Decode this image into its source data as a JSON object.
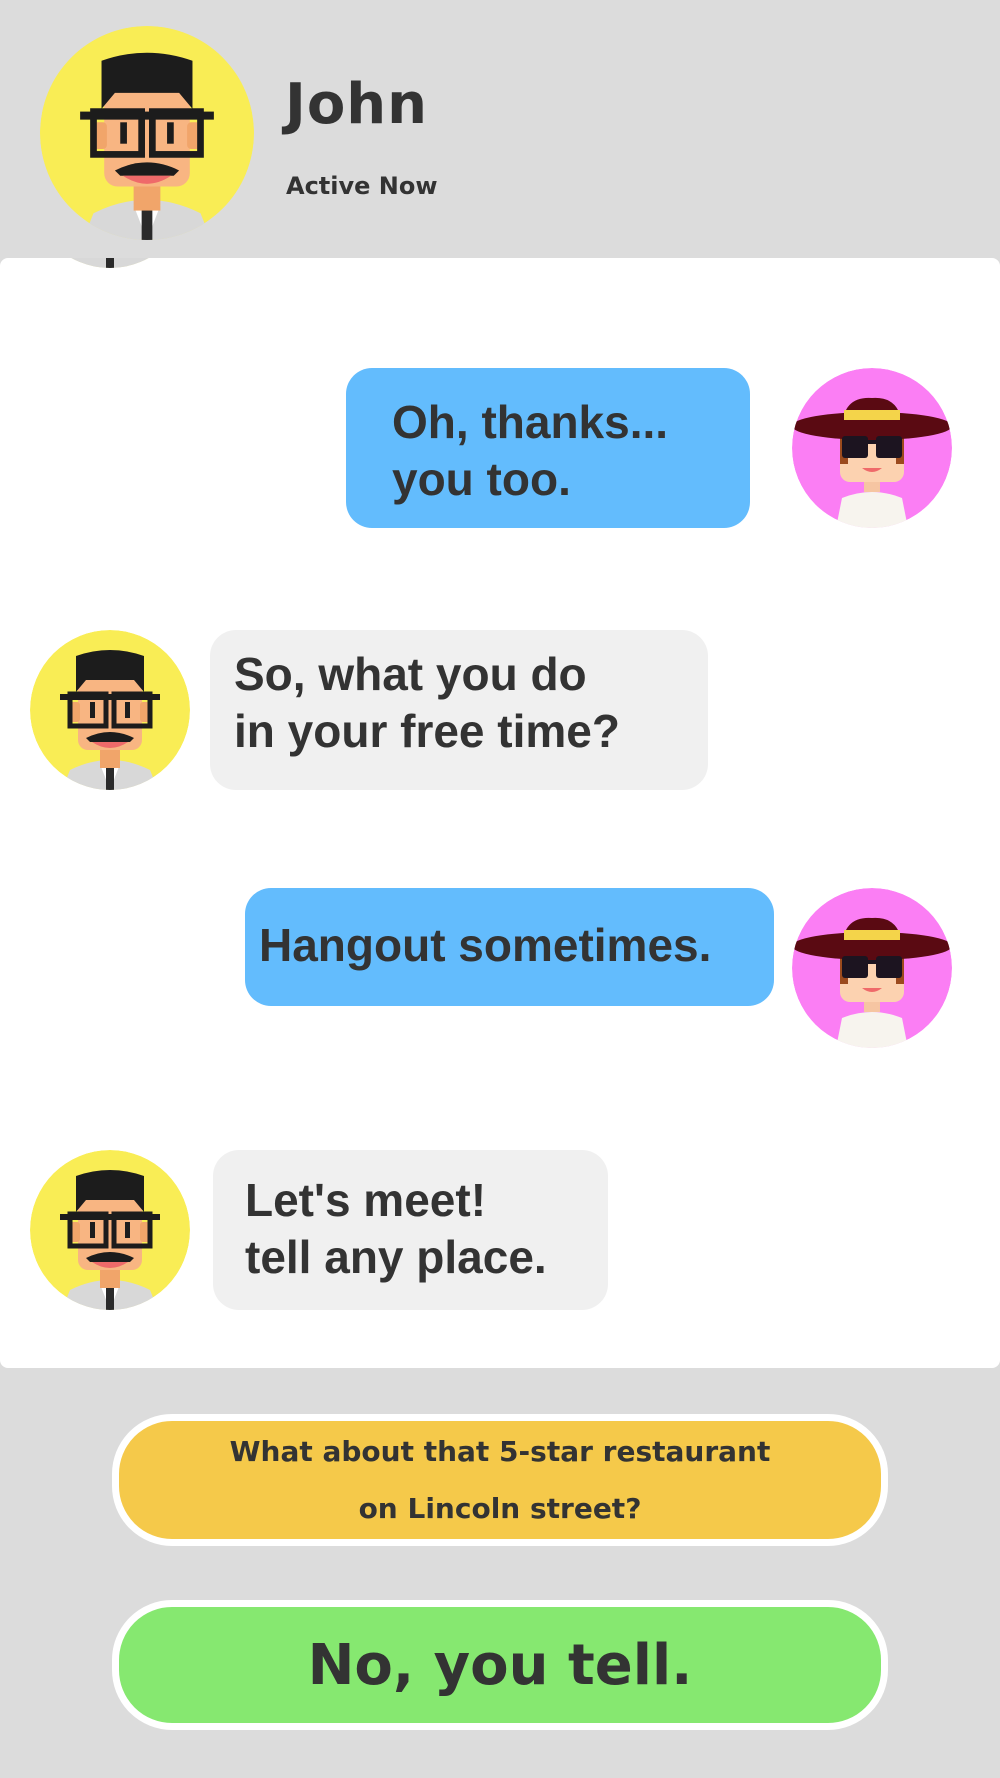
{
  "header": {
    "contact_name": "John",
    "status": "Active Now",
    "avatar_icon": "man-avatar-icon"
  },
  "colors": {
    "outgoing_bubble": "#63bcfd",
    "incoming_bubble": "#f0f0f0",
    "option_yellow": "#f5c94a",
    "option_green": "#86e870",
    "john_avatar_bg": "#f9ed55",
    "user_avatar_bg": "#fb7ef4"
  },
  "messages": [
    {
      "sender": "me",
      "text": "Oh, thanks...\nyou too."
    },
    {
      "sender": "John",
      "text": "So, what you do\nin your free time?"
    },
    {
      "sender": "me",
      "text": "Hangout sometimes."
    },
    {
      "sender": "John",
      "text": "Let's meet!\ntell any place."
    }
  ],
  "reply_options": [
    {
      "label": "What about that 5-star restaurant\non Lincoln street?"
    },
    {
      "label": "No, you tell."
    }
  ]
}
